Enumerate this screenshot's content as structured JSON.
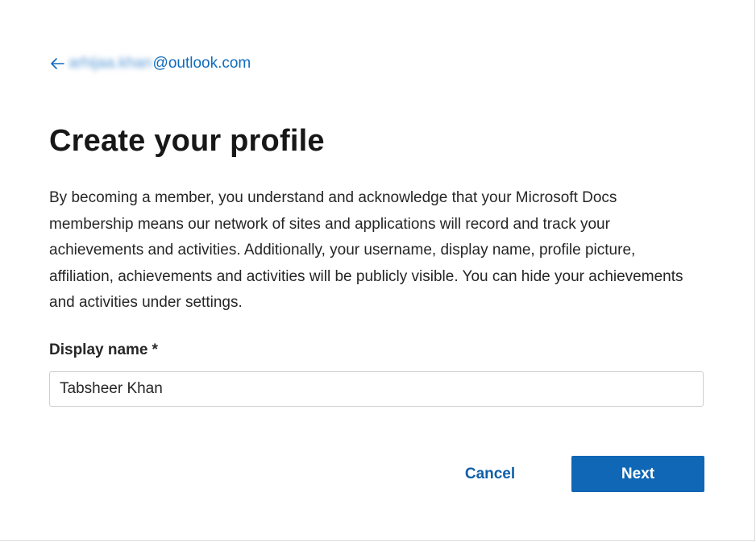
{
  "header": {
    "back_icon": "arrow-left-icon",
    "account_user": "arhijaa.khan",
    "account_domain": "@outlook.com"
  },
  "main": {
    "title": "Create your profile",
    "description": "By becoming a member, you understand and acknowledge that your Microsoft Docs membership means our network of sites and applications will record and track your achievements and activities. Additionally, your username, display name, profile picture, affiliation, achievements and activities will be publicly visible. You can hide your achievements and activities under settings.",
    "display_name_label": "Display name",
    "required_marker": "*",
    "display_name_value": "Tabsheer Khan"
  },
  "actions": {
    "cancel_label": "Cancel",
    "next_label": "Next"
  },
  "colors": {
    "accent": "#0f67b5",
    "link": "#0f6cbd",
    "text": "#171717",
    "input_border": "#cfcfcf"
  }
}
